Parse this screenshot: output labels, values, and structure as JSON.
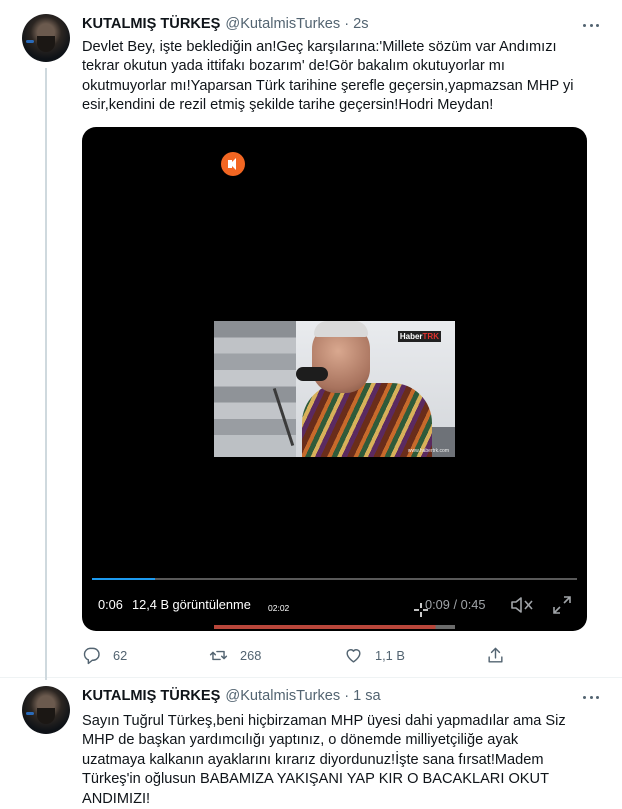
{
  "tweets": [
    {
      "author": {
        "name": "KUTALMIŞ TÜRKEŞ",
        "handle": "@KutalmisTurkes",
        "separator": "·",
        "time": "2s"
      },
      "text_lines": [
        "Devlet Bey, işte beklediğin an!Geç karşılarına:'Millete sözüm var Andımızı",
        "tekrar okutun yada ittifakı bozarım' de!Gör bakalım okutuyorlar mı",
        "okutmuyorlar mı!Yaparsan Türk tarihine şerefle geçersin,yapmazsan MHP yi",
        "esir,kendini de rezil etmiş şekilde tarihe geçersin!Hodri Meydan!"
      ],
      "video": {
        "elapsed": "0:06",
        "views": "12,4 B görüntülenme",
        "duration": "0:09 / 0:45",
        "progress": 0.13,
        "inner_time": "02:02",
        "channel_logo_left": "Haber",
        "channel_logo_right": "TRK",
        "watermark": "www.habertrk.com"
      },
      "actions": {
        "replies": "62",
        "retweets": "268",
        "likes": "1,1 B"
      }
    },
    {
      "author": {
        "name": "KUTALMIŞ TÜRKEŞ",
        "handle": "@KutalmisTurkes",
        "separator": "·",
        "time": "1 sa"
      },
      "text_lines": [
        "Sayın Tuğrul Türkeş,beni hiçbirzaman MHP üyesi dahi yapmadılar ama Siz",
        "MHP de başkan yardımcılığı yaptınız, o dönemde milliyetçiliğe ayak",
        "uzatmaya kalkanın ayaklarını kırarız diyordunuz!İşte sana fırsat!Madem",
        "Türkeş'in oğlusun BABAMIZA YAKIŞANI YAP KIR O BACAKLARI OKUT",
        "ANDIMIZI!"
      ]
    }
  ],
  "colors": {
    "accent": "#1d9bf0",
    "secondary_text": "#536471",
    "sound_badge": "#f26622"
  },
  "icons": [
    "more-icon",
    "sound-on-icon",
    "mute-icon",
    "expand-icon",
    "reply-icon",
    "retweet-icon",
    "like-icon",
    "share-icon"
  ]
}
